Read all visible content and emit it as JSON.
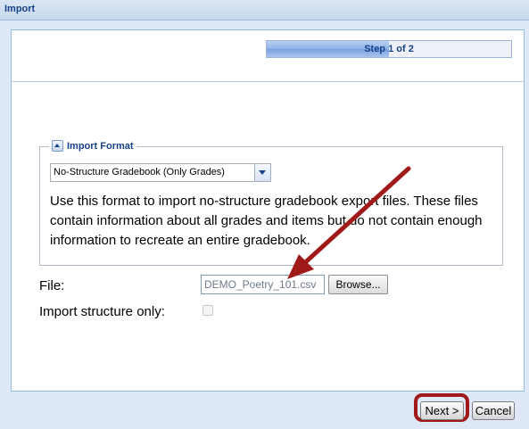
{
  "window": {
    "title": "Import"
  },
  "wizard": {
    "step_label": "Step 1 of 2",
    "progress": 0.5
  },
  "import_format": {
    "legend": "Import Format",
    "selected": "No-Structure Gradebook (Only Grades)",
    "description": "Use this format to import no-structure gradebook export files. These files contain information about all grades and items but do not contain enough information to recreate an entire gradebook."
  },
  "file": {
    "label": "File:",
    "value": "DEMO_Poetry_101.csv",
    "browse_label": "Browse..."
  },
  "structure_only": {
    "label": "Import structure only:",
    "checked": false
  },
  "footer": {
    "next_label": "Next >",
    "cancel_label": "Cancel"
  },
  "colors": {
    "annotation": "#a01a1a",
    "header_text": "#15428b",
    "window_bg": "#dfe8f6"
  },
  "icons": {
    "collapse": "collapse-up-icon",
    "dropdown": "chevron-down-icon"
  }
}
